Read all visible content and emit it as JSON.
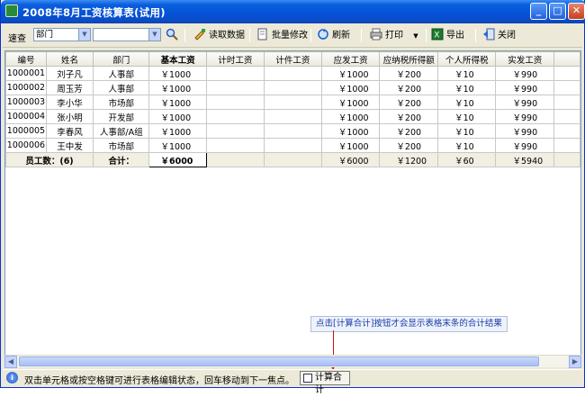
{
  "window": {
    "title": "2008年8月工资核算表(试用)"
  },
  "toolbar": {
    "search_label": "速查",
    "field_select": "部门",
    "value_select": "",
    "read_data": "读取数据",
    "batch_edit": "批量修改",
    "refresh": "刷新",
    "print": "打印",
    "export": "导出",
    "close": "关闭"
  },
  "table": {
    "columns": [
      "编号",
      "姓名",
      "部门",
      "基本工资",
      "计时工资",
      "计件工资",
      "应发工资",
      "应纳税所得额",
      "个人所得税",
      "实发工资"
    ],
    "rows": [
      [
        "1000001",
        "刘子凡",
        "人事部",
        "￥1000",
        "",
        "",
        "￥1000",
        "￥200",
        "￥10",
        "￥990"
      ],
      [
        "1000002",
        "周玉芳",
        "人事部",
        "￥1000",
        "",
        "",
        "￥1000",
        "￥200",
        "￥10",
        "￥990"
      ],
      [
        "1000003",
        "李小华",
        "市场部",
        "￥1000",
        "",
        "",
        "￥1000",
        "￥200",
        "￥10",
        "￥990"
      ],
      [
        "1000004",
        "张小明",
        "开发部",
        "￥1000",
        "",
        "",
        "￥1000",
        "￥200",
        "￥10",
        "￥990"
      ],
      [
        "1000005",
        "李春风",
        "人事部/A组",
        "￥1000",
        "",
        "",
        "￥1000",
        "￥200",
        "￥10",
        "￥990"
      ],
      [
        "1000006",
        "王中发",
        "市场部",
        "￥1000",
        "",
        "",
        "￥1000",
        "￥200",
        "￥10",
        "￥990"
      ]
    ],
    "total": {
      "staff_count": "员工数：(6)",
      "total_label": "合计：",
      "basic": "￥6000",
      "timed": "",
      "piece": "",
      "gross": "￥6000",
      "taxable": "￥1200",
      "tax": "￥60",
      "net": "￥5940"
    }
  },
  "tooltip": "点击[计算合计]按钮才会显示表格末条的合计结果",
  "status": {
    "hint": "双击单元格或按空格键可进行表格编辑状态，回车移动到下一焦点。",
    "calc_button": "计算合计"
  }
}
